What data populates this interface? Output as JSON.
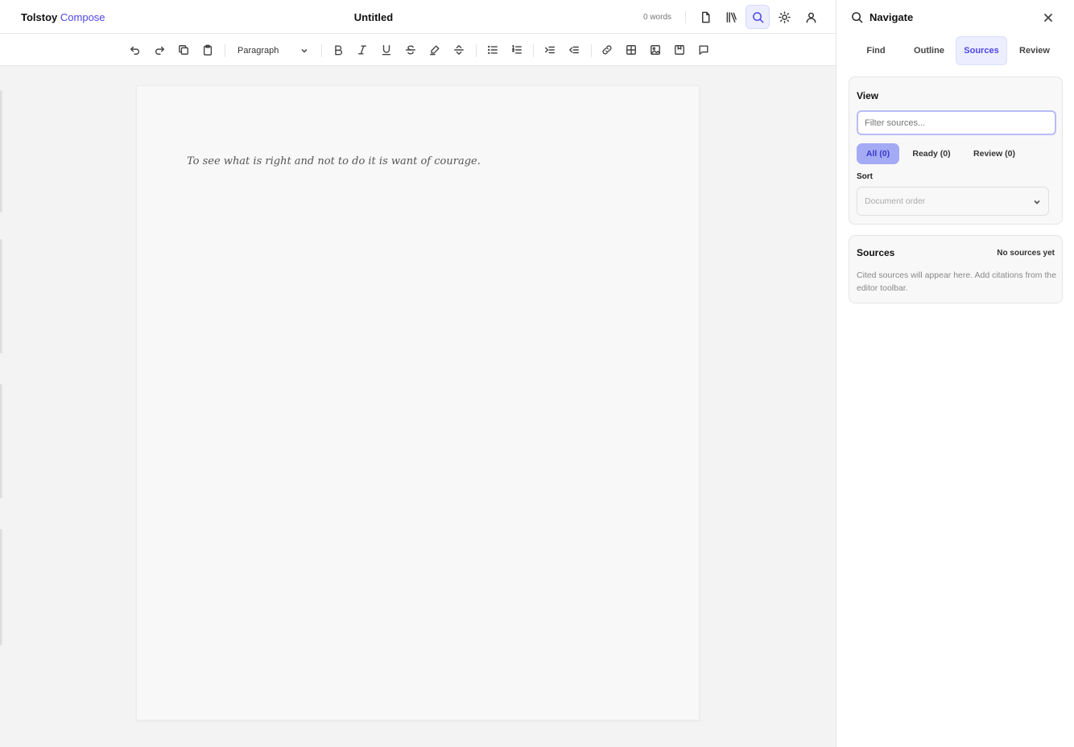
{
  "app": {
    "brand_primary": "Tolstoy",
    "brand_secondary": "Compose",
    "accent_color": "#4f46e5"
  },
  "document": {
    "title": "Untitled",
    "word_count": "0 words",
    "text": "To see what is right and not to do it is want of courage."
  },
  "toolbar": {
    "block_style": "Paragraph"
  },
  "top_icons": [
    "document-icon",
    "library-icon",
    "search-icon",
    "sun-icon",
    "user-icon"
  ],
  "panel": {
    "title": "Navigate",
    "tabs": [
      {
        "label": "Find"
      },
      {
        "label": "Outline"
      },
      {
        "label": "Sources",
        "active": true
      },
      {
        "label": "Review"
      }
    ],
    "view": {
      "heading": "View",
      "filter_placeholder": "Filter sources...",
      "chips": [
        {
          "label": "All (0)",
          "active": true
        },
        {
          "label": "Ready (0)"
        },
        {
          "label": "Review (0)"
        }
      ],
      "sort_label": "Sort",
      "sort_value": "Document order"
    },
    "sources": {
      "heading": "Sources",
      "status": "No sources yet",
      "description": "Cited sources will appear here. Add citations from the editor toolbar."
    }
  }
}
